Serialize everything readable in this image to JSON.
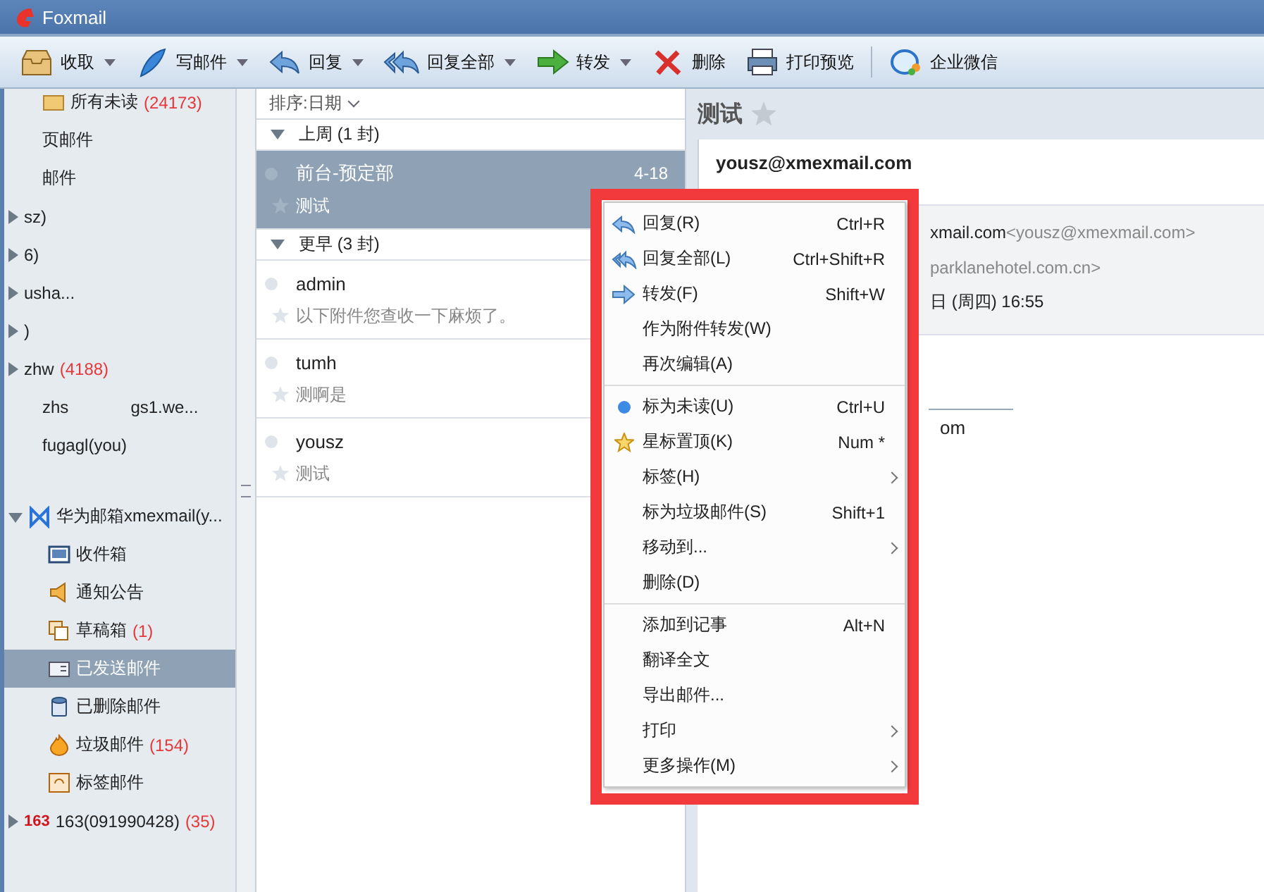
{
  "window": {
    "title": "Foxmail"
  },
  "toolbar": {
    "buttons": [
      {
        "kind": "receive",
        "label": "收取",
        "dropdown": true
      },
      {
        "kind": "compose",
        "label": "写邮件",
        "dropdown": true
      },
      {
        "kind": "reply",
        "label": "回复",
        "dropdown": true
      },
      {
        "kind": "reply-all",
        "label": "回复全部",
        "dropdown": true
      },
      {
        "kind": "forward",
        "label": "转发",
        "dropdown": true
      },
      {
        "kind": "delete",
        "label": "删除",
        "dropdown": false
      },
      {
        "kind": "print",
        "label": "打印预览",
        "dropdown": false
      },
      {
        "kind": "chat",
        "label": "企业微信",
        "dropdown": false
      }
    ]
  },
  "sidebar": {
    "items": [
      {
        "kind": "folder",
        "label": "所有未读",
        "count": "(24173)",
        "selected": false
      },
      {
        "kind": "plain",
        "label": "页邮件",
        "selected": false
      },
      {
        "kind": "plain",
        "label": "邮件",
        "selected": false
      },
      {
        "kind": "account",
        "label": "sz)",
        "expanded": false,
        "selected": false
      },
      {
        "kind": "account",
        "label": "6)",
        "expanded": false,
        "selected": false
      },
      {
        "kind": "account",
        "label": "usha...",
        "expanded": false,
        "selected": false
      },
      {
        "kind": "account",
        "label": ")",
        "expanded": false,
        "selected": false
      },
      {
        "kind": "account",
        "label": "zhw",
        "count": "(4188)",
        "expanded": false,
        "selected": false
      },
      {
        "kind": "plain",
        "label": "zhs",
        "suffix": "gs1.we...",
        "selected": false
      },
      {
        "kind": "plain",
        "label": "fugagl(you)",
        "selected": false
      },
      {
        "kind": "account",
        "label": "华为邮箱xmexmail(y...",
        "expanded": true,
        "selected": false,
        "children": [
          {
            "kind": "inbox",
            "label": "收件箱",
            "selected": false
          },
          {
            "kind": "notice",
            "label": "通知公告",
            "selected": false
          },
          {
            "kind": "drafts",
            "label": "草稿箱",
            "count": "(1)",
            "selected": false
          },
          {
            "kind": "sent",
            "label": "已发送邮件",
            "selected": true
          },
          {
            "kind": "trash",
            "label": "已删除邮件",
            "selected": false
          },
          {
            "kind": "junk",
            "label": "垃圾邮件",
            "count": "(154)",
            "selected": false
          },
          {
            "kind": "tagged",
            "label": "标签邮件",
            "selected": false
          }
        ]
      },
      {
        "kind": "account",
        "label": "163(091990428)",
        "count": "(35)",
        "expanded": false,
        "selected": false,
        "badge": "163"
      }
    ]
  },
  "message_list": {
    "sort": "排序:日期",
    "groups": [
      {
        "label": "上周 (1 封)",
        "expanded": true,
        "messages": [
          {
            "sender": "前台-预定部",
            "subject": "测试",
            "date": "4-18",
            "selected": true,
            "unread": false,
            "starred": false
          }
        ]
      },
      {
        "label": "更早 (3 封)",
        "expanded": true,
        "messages": [
          {
            "sender": "admin",
            "subject": "以下附件您查收一下麻烦了。",
            "selected": false,
            "unread": false,
            "starred": false
          },
          {
            "sender": "tumh",
            "subject": "测啊是",
            "selected": false,
            "unread": false,
            "starred": false
          },
          {
            "sender": "yousz",
            "subject": "测试",
            "selected": false,
            "unread": false,
            "starred": false
          }
        ]
      }
    ]
  },
  "reader": {
    "subject": "测试",
    "starred": false,
    "from": "yousz@xmexmail.com",
    "details": [
      {
        "main": "xmail.com",
        "extra": "<yousz@xmexmail.com>"
      },
      {
        "extra": "parklanehotel.com.cn>"
      },
      {
        "main": "日 (周四) 16:55"
      }
    ],
    "body": "om"
  },
  "context_menu": {
    "sections": [
      [
        {
          "label": "回复(R)",
          "shortcut": "Ctrl+R",
          "submenu": false
        },
        {
          "label": "回复全部(L)",
          "shortcut": "Ctrl+Shift+R",
          "submenu": false
        },
        {
          "label": "转发(F)",
          "shortcut": "Shift+W",
          "submenu": false
        },
        {
          "label": "作为附件转发(W)",
          "submenu": false
        },
        {
          "label": "再次编辑(A)",
          "submenu": false
        }
      ],
      [
        {
          "label": "标为未读(U)",
          "shortcut": "Ctrl+U",
          "submenu": false
        },
        {
          "label": "星标置顶(K)",
          "shortcut": "Num *",
          "submenu": false
        },
        {
          "label": "标签(H)",
          "submenu": true
        },
        {
          "label": "标为垃圾邮件(S)",
          "shortcut": "Shift+1",
          "submenu": false
        },
        {
          "label": "移动到...",
          "submenu": true
        },
        {
          "label": "删除(D)",
          "submenu": false
        }
      ],
      [
        {
          "label": "添加到记事",
          "shortcut": "Alt+N",
          "submenu": false
        },
        {
          "label": "翻译全文",
          "submenu": false
        },
        {
          "label": "导出邮件...",
          "submenu": false
        },
        {
          "label": "打印",
          "submenu": true
        },
        {
          "label": "更多操作(M)",
          "submenu": true
        }
      ]
    ]
  }
}
